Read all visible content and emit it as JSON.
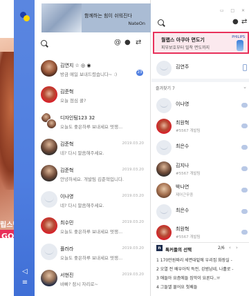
{
  "ad_left": {
    "line1": "립스틱",
    "line2": "GO >"
  },
  "sidebar": {
    "badges": [
      "",
      "",
      ""
    ],
    "bottom_icons": [
      "speaker-icon",
      "menu-icon"
    ]
  },
  "banner": {
    "line1": "함께하는 힘이 쉬워진다",
    "line2": "NateOn"
  },
  "chat_toolbar": {
    "at_icon": "@"
  },
  "chats": [
    {
      "name": "김연지 ☆ ◎ ◉",
      "message": "방금 메일 보내드렸습니다~ :)",
      "date": "",
      "count": "23",
      "avatar": "photo"
    },
    {
      "name": "김준혁",
      "message": "오늘 점심 콜?",
      "date": "",
      "count": "",
      "avatar": "red"
    },
    {
      "name": "디자인팀123 32",
      "message": "오늘도 좋은하루 보내세요 멋쟁...",
      "date": "",
      "count": "",
      "avatar": "multi"
    },
    {
      "name": "김준혁",
      "message": "네? 다시 말씀해주세요.",
      "date": "2019.03.20",
      "count": "",
      "avatar": "dark"
    },
    {
      "name": "김준혁",
      "message": "안녕하세요. 개발팀 김준혁입니다.",
      "date": "2019.03.20",
      "count": "",
      "avatar": "dark"
    },
    {
      "name": "이나영",
      "message": "네? 다시 말씀해주세요.",
      "date": "2019.03.20",
      "count": "",
      "avatar": "blank"
    },
    {
      "name": "최수민",
      "message": "오늘도 좋은하루 보내세요 멋쟁...",
      "date": "2019.03.20",
      "count": "",
      "avatar": "red"
    },
    {
      "name": "플러라",
      "message": "오늘도 좋은하루 보내세요 멋쟁...",
      "date": "2019.03.20",
      "count": "",
      "avatar": "blank"
    },
    {
      "name": "서현진",
      "message": "바빠? 잠시 자리로~",
      "date": "2019.03.20",
      "count": "",
      "avatar": "suit"
    }
  ],
  "friend_ad": {
    "line1": "월랩스 아쿠아 면도기",
    "line2": "피부보호부터 밀착 면도까지",
    "brand": "PHILIPS"
  },
  "me": {
    "name": "김연주"
  },
  "favorites_label": "즐겨찾기 7",
  "friends": [
    {
      "name": "이나영",
      "sub": "",
      "avatar": "blank"
    },
    {
      "name": "최원혁",
      "sub": "#5567 개발팀",
      "avatar": "photo"
    },
    {
      "name": "최은수",
      "sub": "",
      "avatar": "blank"
    },
    {
      "name": "김지나",
      "sub": "#5567 개발팀",
      "avatar": "dark"
    },
    {
      "name": "박나연",
      "sub": "제어근무중",
      "avatar": "warm"
    },
    {
      "name": "최은수",
      "sub": "",
      "avatar": "blank"
    },
    {
      "name": "최원혁",
      "sub": "#5567 개발팀",
      "avatar": "photo"
    }
  ],
  "news": {
    "logo": "n",
    "title": "톡커들의 선택",
    "page": "2/6",
    "items": [
      "1 170만원짜리 세면대밑에 우리집 화장실 -",
      "2 오열 전 배우아직 득전, 강범남네, 나홀로 -",
      "3 애들아 요즘에들 짐막이 요른다..ㅠ",
      "4 그들앨 물어요 첫째들"
    ]
  }
}
